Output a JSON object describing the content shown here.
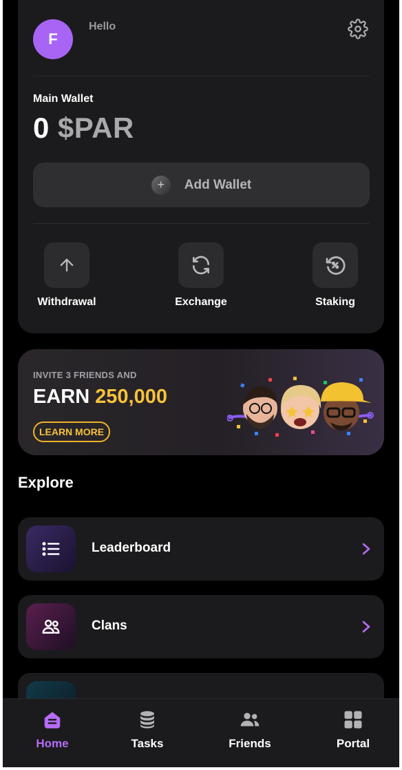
{
  "header": {
    "avatar_letter": "F",
    "greeting": "Hello",
    "settings_icon": "gear-icon"
  },
  "wallet": {
    "label": "Main Wallet",
    "amount": "0",
    "currency": "$PAR",
    "add_button_label": "Add Wallet"
  },
  "actions": [
    {
      "label": "Withdrawal",
      "icon": "arrow-up-icon"
    },
    {
      "label": "Exchange",
      "icon": "refresh-icon"
    },
    {
      "label": "Staking",
      "icon": "staking-icon"
    }
  ],
  "banner": {
    "invite_text": "INVITE 3 FRIENDS AND",
    "earn_word": "EARN",
    "earn_amount": "250,000",
    "learn_more": "LEARN MORE",
    "accent_color": "#f6c23a"
  },
  "explore": {
    "title": "Explore",
    "items": [
      {
        "label": "Leaderboard",
        "icon": "list-icon"
      },
      {
        "label": "Clans",
        "icon": "group-icon"
      }
    ]
  },
  "tabs": [
    {
      "label": "Home",
      "icon": "home-icon",
      "active": true
    },
    {
      "label": "Tasks",
      "icon": "coins-icon",
      "active": false
    },
    {
      "label": "Friends",
      "icon": "friends-icon",
      "active": false
    },
    {
      "label": "Portal",
      "icon": "grid-icon",
      "active": false
    }
  ],
  "colors": {
    "accent_purple": "#b66cf7",
    "background": "#000000",
    "card": "#1b1b1d"
  }
}
